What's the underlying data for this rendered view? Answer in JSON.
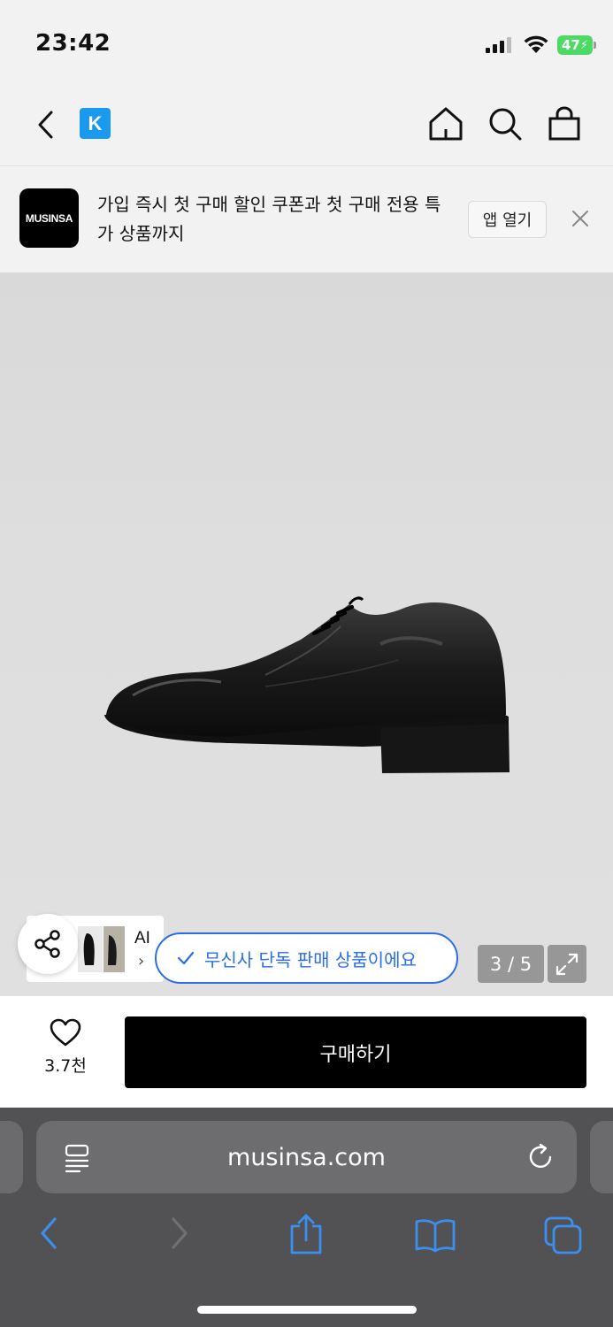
{
  "status_bar": {
    "time": "23:42",
    "battery": "47",
    "signal_icon": "cellular-signal-icon",
    "wifi_icon": "wifi-icon"
  },
  "top_nav": {
    "back_icon": "chevron-left-icon",
    "logo_letter": "K",
    "home_icon": "home-icon",
    "search_icon": "search-icon",
    "cart_icon": "shopping-bag-icon"
  },
  "app_banner": {
    "logo_text": "MUSINSA",
    "message": "가입 즉시 첫 구매 할인 쿠폰과 첫 구매 전용 특가 상품까지",
    "open_app_label": "앱 열기",
    "close_icon": "close-icon"
  },
  "product_gallery": {
    "ai_label": "AI",
    "exclusive_label": "무신사 단독 판매 상품이에요",
    "counter": "3 / 5",
    "share_icon": "share-icon",
    "expand_icon": "expand-icon"
  },
  "action_bar": {
    "like_icon": "heart-icon",
    "like_count": "3.7천",
    "buy_label": "구매하기"
  },
  "safari": {
    "url": "musinsa.com",
    "reader_icon": "reader-icon",
    "reload_icon": "reload-icon",
    "toolbar": [
      "back-icon",
      "forward-icon",
      "share-icon",
      "bookmarks-icon",
      "tabs-icon"
    ],
    "accent_color": "#3b8ff0"
  }
}
